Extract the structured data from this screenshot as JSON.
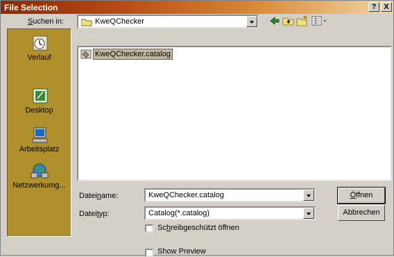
{
  "title": "File Selection",
  "title_buttons": {
    "help": "?",
    "close": "X"
  },
  "lookin": {
    "label_pre": "",
    "label_u": "S",
    "label_post": "uchen in:",
    "value": "KweQChecker"
  },
  "places": [
    {
      "label": "Verlauf",
      "icon": "history-icon"
    },
    {
      "label": "Desktop",
      "icon": "desktop-icon"
    },
    {
      "label": "Arbeitsplatz",
      "icon": "my-computer-icon"
    },
    {
      "label": "Netzwerkumg...",
      "icon": "network-icon"
    }
  ],
  "files": [
    {
      "name": "KweQChecker.catalog",
      "icon": "catalog-file-icon"
    }
  ],
  "filename": {
    "label_pre": "Datei",
    "label_u": "n",
    "label_post": "ame:",
    "value": "KweQChecker.catalog"
  },
  "filetype": {
    "label_pre": "Datei",
    "label_u": "t",
    "label_post": "yp:",
    "value": "Catalog(*.catalog)"
  },
  "readonly": {
    "label_pre": "Sc",
    "label_u": "h",
    "label_post": "reibgeschützt öffnen",
    "checked": false
  },
  "preview": {
    "label": "Show Preview",
    "checked": false
  },
  "buttons": {
    "open_u": "Ö",
    "open_post": "ffnen",
    "cancel": "Abbrechen"
  }
}
